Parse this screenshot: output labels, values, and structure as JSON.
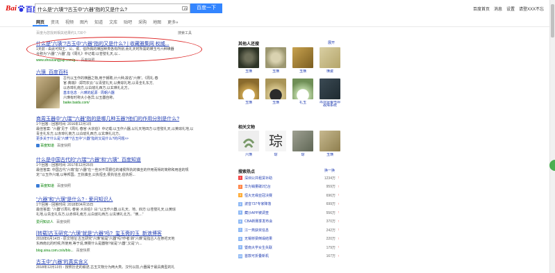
{
  "header": {
    "logo_left": "Bai",
    "logo_right": "百度",
    "query": "什么是“六璜”?古玉中“六器”指的又是什么?",
    "search_button": "百度一下",
    "top_links": [
      "百度首页",
      "消息",
      "设置",
      "请登XXX不忘"
    ]
  },
  "tabs": [
    "网页",
    "资讯",
    "视频",
    "图片",
    "知道",
    "文库",
    "贴吧",
    "采购",
    "地图",
    "更多»"
  ],
  "stats": "百度为您找到相关结果约1,730个",
  "tools": "搜索工具",
  "results": [
    {
      "title_a": "什么是“六璜”?古玉中“六器”指的又是什么? | 收藏雅集网 权威...",
      "lines": [
        "1天前 - 由此可知王、公、侯、伯所佩的璜因种类各有所别,而礼天时所需的璜玉与六种璜器",
        "合称为“六器”,“六器”,指《周礼》中记载:以苍璧礼天,以..."
      ],
      "url": "www.shoucangyaji.com/g...",
      "snap": "百度快照"
    },
    {
      "title_a": "六璜_百度百科",
      "lines": [
        "古代以玉作的璜器之物,用于朝聘,计六种,故名“六璜”。《周礼·春",
        "官·典瑞》:郑司农云:“以青璧礼天,以黄琮礼地,以青圭礼东方,",
        "以赤璋礼南方,以白琥礼西方,以玄璜礼北方。",
        "基本信息 · 六璜的起源 · 周朝六器",
        "六璜有时称大小各异,以玉器自称。"
      ],
      "url": "baike.baidu.com/",
      "snap": ""
    },
    {
      "title_a": "商周玉器中“六瑞”“六器”指的是哪几种玉器?他们的作用分别是什么?",
      "lines": [
        "1个回答 - 回答时间: 2016年12月1日",
        "最佳答案: “六器”见于《周礼·春官·大宗伯》中记载:以玉作六器,以礼天地四方:以苍璧礼天,以黄琮礼地,以",
        "青圭礼东方,以赤璋礼南方,以白琥礼西方,以玄璜礼北方。",
        "更多关于什么是“六璜”?古玉中“六器”指的又是什么?的问题>>"
      ],
      "url": "百度知道",
      "snap": "百度快照"
    },
    {
      "title_a": "什么是中国古代的“六瑞”“六器”和“六璜”_百度知道",
      "lines": [
        "1个回答 - 回答时间: 2017年12月25日",
        "最佳答案: 中国古代“六瑞”指“六器”在一些对不同爵位的诸侯所执的镇圭的作用而得的简称和用途的规",
        "定:“以玉作六瑞,以等邦国。王执镇圭,公执桓圭,侯执信圭,伯执躬..."
      ],
      "url": "百度知道",
      "snap": "百度快照"
    },
    {
      "title_a": "“六器”和“六璜”是什么? - 爱问知识人",
      "lines": [
        "1个回答 - 回答时间: 2018年04月15日",
        "最佳答案: “六器”(《周礼·春官·大宗伯》曰:“以玉作六器,以礼天、地、四方:以苍璧礼天,以黄琮",
        "礼地,以青圭礼东方,以赤璋礼南方,以白琥礼西方,以玄璜礼北方。“璜,...”"
      ],
      "url": "爱问知识人",
      "snap": "百度快照"
    },
    {
      "title_a": "[转载]古玉研究:“六璜”就是“六器”吗?_玺玉斋的玉_新浪博客",
      "lines": [
        "2018年6月14日 - 原文地址:古玉研究“六璜”就是“六器”吗?作者:转“六璜”是指古人在祭祀天地",
        "东西南北的时候,所使用,等于说,璜赛什么是器物?就是“六器”,又是“六..."
      ],
      "url": "blog.sina.com.cn/s/blo...",
      "snap": "百度快照"
    },
    {
      "title_a": "古玉中“六器”的真实含义",
      "lines": [
        "2018年12月13日 - 按照历史的叙述,古玉文物分为两大类。汉代以前,六器属于最具典型的礼"
      ],
      "url": "",
      "snap": ""
    }
  ],
  "side": {
    "also_searched_title": "其他人还搜",
    "expand": "展开",
    "also_searched": [
      "玉璜",
      "玉璜",
      "玉璜",
      "璜瓷",
      "玉璜",
      "玉璜",
      "礼玉",
      "玉瓷",
      "再现设备电源故障系统"
    ],
    "related_title": "相关文物",
    "related": [
      "六璜",
      "琮",
      "琮",
      "玉璜"
    ],
    "hot_title": "搜索热点",
    "hot_refresh": "换一换",
    "hot": [
      {
        "rank": "1",
        "name": "深圳公共租赁补助",
        "val": "1234万"
      },
      {
        "rank": "2",
        "name": "华为销量破2亿台",
        "val": "959万"
      },
      {
        "rank": "3",
        "name": "恒大无缘亚冠决赛",
        "val": "696万"
      },
      {
        "rank": "4",
        "name": "波音737专家降落",
        "val": "699万"
      },
      {
        "rank": "5",
        "name": "藏沙APP被调查",
        "val": "556万"
      },
      {
        "rank": "6",
        "name": "CBA新赛季发布会",
        "val": "370万"
      },
      {
        "rank": "7",
        "name": "江一燕获奖信息",
        "val": "242万"
      },
      {
        "rank": "8",
        "name": "无锡桥梁倒塌结果",
        "val": "220万"
      },
      {
        "rank": "9",
        "name": "暨南大学女生失联",
        "val": "179万"
      },
      {
        "rank": "10",
        "name": "首款可折叠新机",
        "val": "167万"
      }
    ]
  },
  "colors": {
    "brand_blue": "#3385ff",
    "link": "#2440b3",
    "keyword_red": "#c00",
    "url_green": "#008000",
    "oval": "#d22"
  }
}
